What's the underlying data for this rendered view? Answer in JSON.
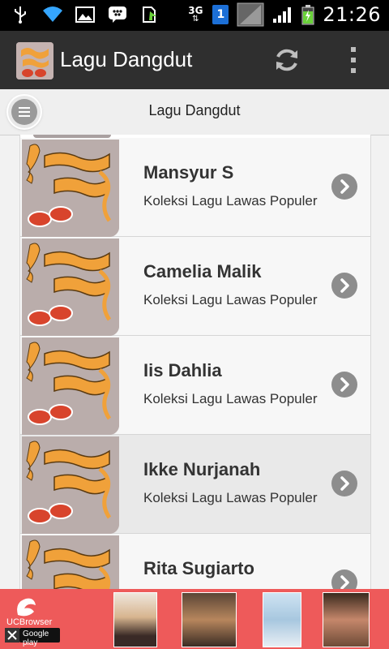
{
  "status_bar": {
    "network": "3G",
    "sim": "1",
    "time": "21:26"
  },
  "app_bar": {
    "title": "Lagu Dangdut"
  },
  "sub_bar": {
    "title": "Lagu Dangdut"
  },
  "list": {
    "items": [
      {
        "name": "Mansyur S",
        "subtitle": "Koleksi Lagu Lawas Populer"
      },
      {
        "name": "Camelia Malik",
        "subtitle": "Koleksi Lagu Lawas Populer"
      },
      {
        "name": "Iis Dahlia",
        "subtitle": "Koleksi Lagu Lawas Populer"
      },
      {
        "name": "Ikke Nurjanah",
        "subtitle": "Koleksi Lagu Lawas Populer"
      },
      {
        "name": "Rita Sugiarto",
        "subtitle": ""
      }
    ]
  },
  "ad": {
    "brand": "UCBrowser",
    "store": "Google play"
  }
}
